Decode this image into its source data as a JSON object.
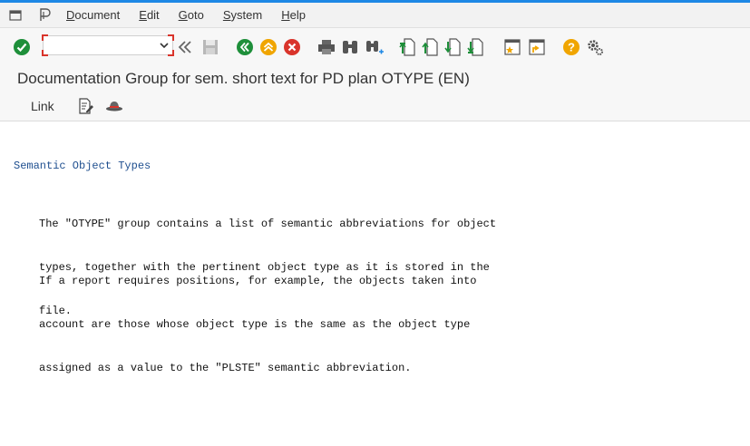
{
  "menubar": {
    "items": [
      {
        "label": "Document",
        "accel": "D",
        "rest": "ocument"
      },
      {
        "label": "Edit",
        "accel": "E",
        "rest": "dit"
      },
      {
        "label": "Goto",
        "accel": "G",
        "rest": "oto"
      },
      {
        "label": "System",
        "accel": "S",
        "rest": "ystem"
      },
      {
        "label": "Help",
        "accel": "H",
        "rest": "elp"
      }
    ]
  },
  "command_field": {
    "value": ""
  },
  "title": "Documentation Group for sem. short text for PD plan  OTYPE (EN)",
  "app_toolbar": {
    "link_label": "Link"
  },
  "content": {
    "heading": "Semantic Object Types",
    "paragraph1_lines": [
      "The \"OTYPE\" group contains a list of semantic abbreviations for object",
      "types, together with the pertinent object type as it is stored in the",
      "file."
    ],
    "paragraph2_lines": [
      "If a report requires positions, for example, the objects taken into",
      "account are those whose object type is the same as the object type",
      "assigned as a value to the \"PLSTE\" semantic abbreviation."
    ]
  },
  "colors": {
    "accent": "#1e88e5",
    "ok_green": "#1e8f3a",
    "warn_orange": "#f0a500",
    "cancel_red": "#d9342b",
    "heading_blue": "#1f4f8f"
  }
}
